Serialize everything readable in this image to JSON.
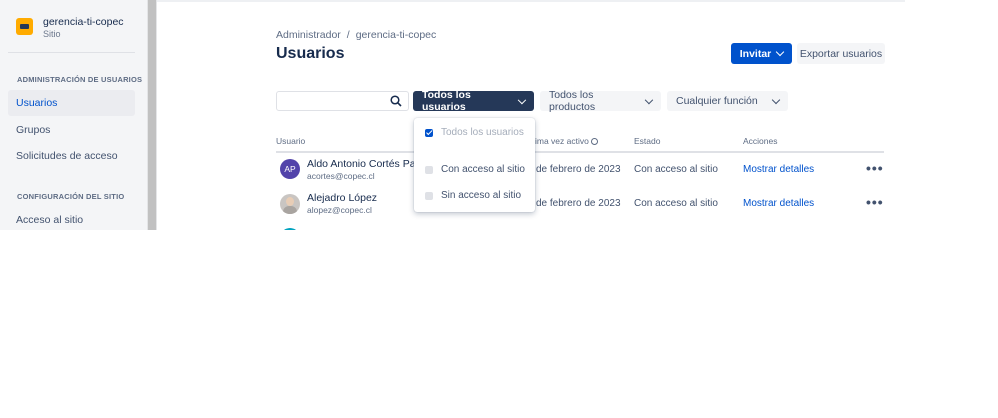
{
  "site": {
    "name": "gerencia-ti-copec",
    "subtitle": "Sitio"
  },
  "sidebar": {
    "section1": "ADMINISTRACIÓN DE USUARIOS",
    "items": [
      {
        "label": "Usuarios",
        "active": true
      },
      {
        "label": "Grupos"
      },
      {
        "label": "Solicitudes de acceso"
      }
    ],
    "section2": "CONFIGURACIÓN DEL SITIO",
    "items2": [
      {
        "label": "Acceso al sitio"
      }
    ]
  },
  "breadcrumb": {
    "root": "Administrador",
    "separator": "/",
    "current": "gerencia-ti-copec"
  },
  "page_title": "Usuarios",
  "header_buttons": {
    "invite": "Invitar",
    "export": "Exportar usuarios"
  },
  "search": {
    "value": "",
    "placeholder": ""
  },
  "filters": {
    "users": "Todos los usuarios",
    "products": "Todos los productos",
    "role": "Cualquier función"
  },
  "table": {
    "headers": {
      "user": "Usuario",
      "last_active": "ima vez activo",
      "status": "Estado",
      "actions": "Acciones"
    },
    "rows": [
      {
        "initials": "AP",
        "name": "Aldo Antonio Cortés Pasté",
        "email": "acortes@copec.cl",
        "last_active": "de febrero de 2023",
        "status": "Con acceso al sitio",
        "action": "Mostrar detalles",
        "more": "•••"
      },
      {
        "initials": "",
        "name": "Alejadro López",
        "email": "alopez@copec.cl",
        "last_active": "de febrero de 2023",
        "status": "Con acceso al sitio",
        "action": "Mostrar detalles",
        "more": "•••"
      }
    ]
  },
  "dropdown": {
    "options": [
      {
        "label": "Todos los usuarios",
        "checked": true,
        "disabled": true
      },
      {
        "label": "Con acceso al sitio",
        "checked": false
      },
      {
        "label": "Sin acceso al sitio",
        "checked": false
      }
    ]
  },
  "colors": {
    "primary": "#0052cc",
    "dark_filter": "#253858",
    "avatar": "#5243aa",
    "site_logo": "#ffab00"
  },
  "icons": {
    "search": "search-icon",
    "chevron": "chevron-down-icon",
    "more": "more-icon",
    "info": "info-icon"
  }
}
